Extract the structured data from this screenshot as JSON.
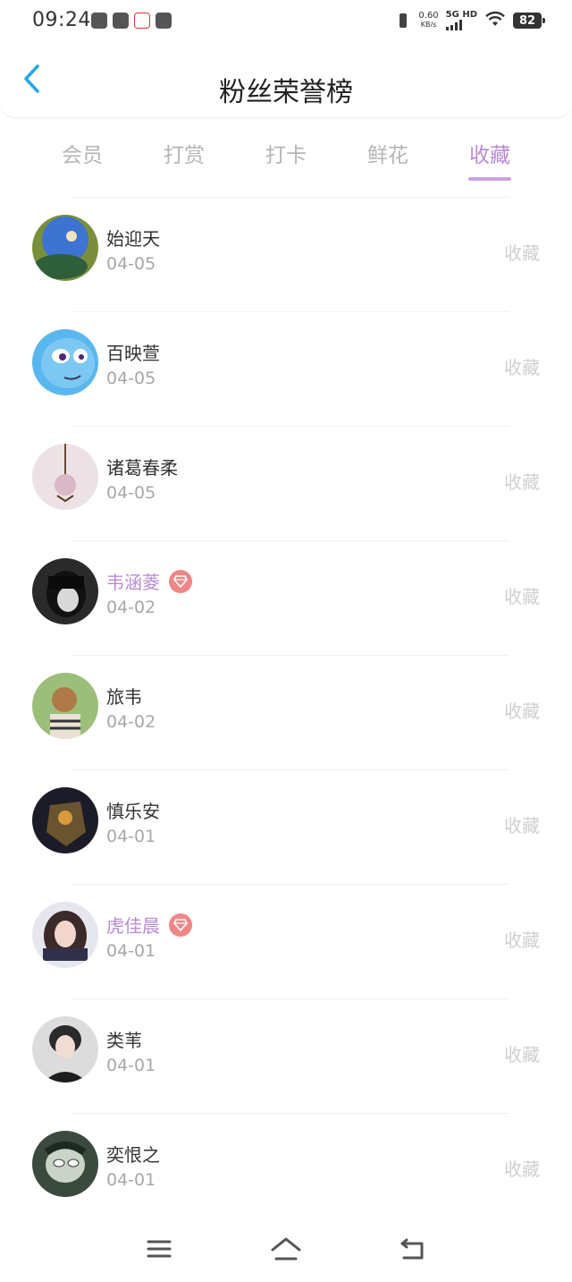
{
  "status_bar": {
    "time": "09:24",
    "net_speed_value": "0.60",
    "net_speed_unit": "KB/s",
    "network": "5G HD",
    "battery": "82"
  },
  "header": {
    "title": "粉丝荣誉榜",
    "back_icon": "chevron-left-icon"
  },
  "tabs": [
    {
      "label": "会员",
      "active": false
    },
    {
      "label": "打赏",
      "active": false
    },
    {
      "label": "打卡",
      "active": false
    },
    {
      "label": "鲜花",
      "active": false
    },
    {
      "label": "收藏",
      "active": true
    }
  ],
  "colors": {
    "accent": "#b98ad6",
    "back_icon": "#2aa7e8",
    "gem_badge": "#f08686"
  },
  "fans": [
    {
      "name": "始迎天",
      "date": "04-05",
      "action": "收藏",
      "vip": false
    },
    {
      "name": "百映萱",
      "date": "04-05",
      "action": "收藏",
      "vip": false
    },
    {
      "name": "诸葛春柔",
      "date": "04-05",
      "action": "收藏",
      "vip": false
    },
    {
      "name": "韦涵菱",
      "date": "04-02",
      "action": "收藏",
      "vip": true
    },
    {
      "name": "旅韦",
      "date": "04-02",
      "action": "收藏",
      "vip": false
    },
    {
      "name": "慎乐安",
      "date": "04-01",
      "action": "收藏",
      "vip": false
    },
    {
      "name": "虎佳晨",
      "date": "04-01",
      "action": "收藏",
      "vip": true
    },
    {
      "name": "类苇",
      "date": "04-01",
      "action": "收藏",
      "vip": false
    },
    {
      "name": "奕恨之",
      "date": "04-01",
      "action": "收藏",
      "vip": false
    }
  ],
  "nav_bar": {
    "menu_icon": "menu-icon",
    "home_icon": "home-icon",
    "back_icon": "back-icon"
  }
}
